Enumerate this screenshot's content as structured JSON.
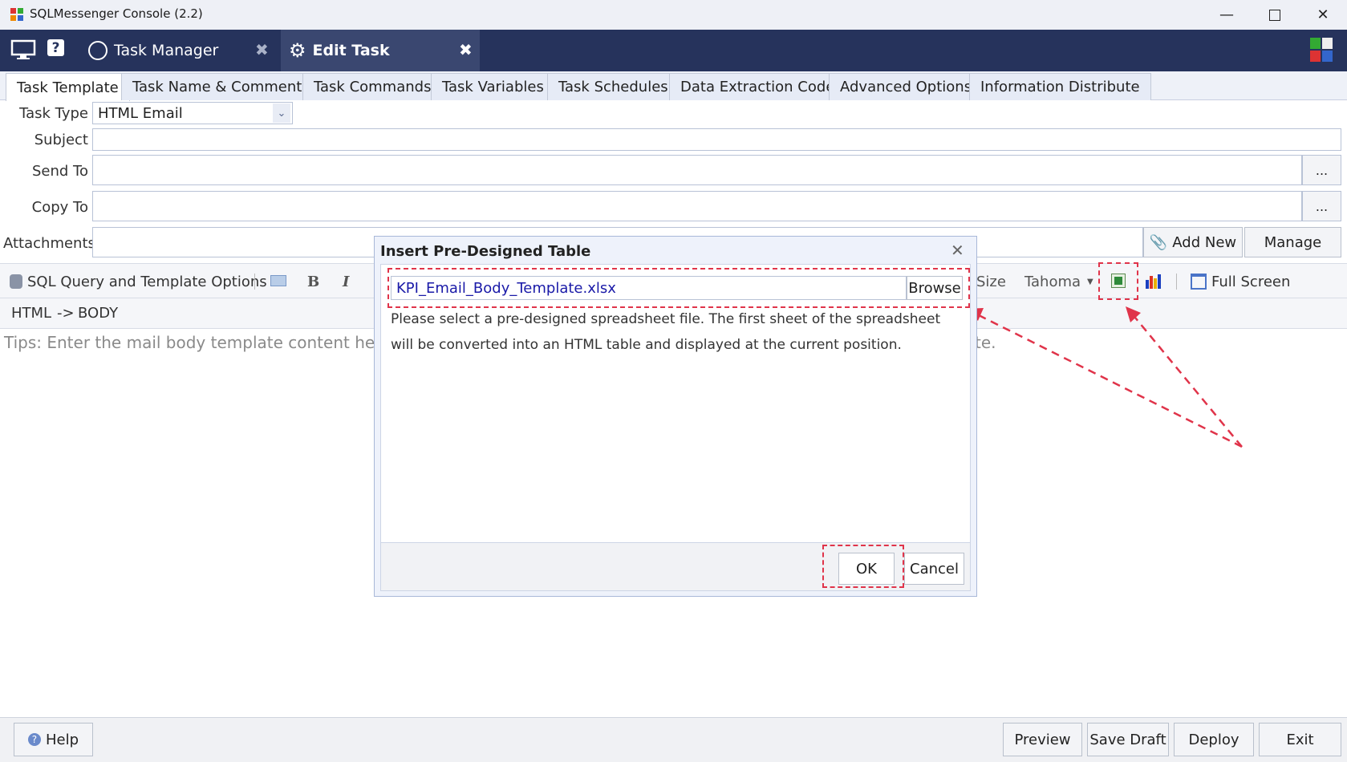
{
  "window": {
    "title": "SQLMessenger Console (2.2)",
    "controls": [
      "minimize-icon",
      "maximize-icon",
      "close-icon"
    ]
  },
  "nav": {
    "tabs": [
      {
        "label": "Task Manager",
        "icon": "task-manager-icon"
      },
      {
        "label": "Edit Task",
        "icon": "gear-icon"
      }
    ]
  },
  "subtabs": [
    "Task Template",
    "Task Name & Comments",
    "Task Commands",
    "Task Variables",
    "Task Schedules",
    "Data Extraction Code",
    "Advanced Options",
    "Information Distribute"
  ],
  "form": {
    "task_type_label": "Task Type",
    "task_type_value": "HTML Email",
    "subject_label": "Subject",
    "send_to_label": "Send To",
    "copy_to_label": "Copy To",
    "attachments_label": "Attachments",
    "dots_label": "...",
    "add_new_label": "Add New",
    "manage_label": "Manage"
  },
  "toolbar": {
    "sql_options_label": "SQL Query and Template Options",
    "bold_label": "B",
    "italic_label": "I",
    "size_label": "Size",
    "font_label": "Tahoma",
    "full_screen_label": "Full Screen"
  },
  "breadcrumb": {
    "html": "HTML",
    "arrow": "->",
    "body": "BODY"
  },
  "editor": {
    "tip_left": "Tips: Enter the mail body template content here,",
    "tip_right": "te."
  },
  "dialog": {
    "title": "Insert Pre-Designed Table",
    "file_value": "KPI_Email_Body_Template.xlsx",
    "browse_label": "Browse",
    "desc_line1": "Please select a pre-designed spreadsheet file. The first sheet of the spreadsheet",
    "desc_line2": "will be converted into an HTML table and displayed at the current position.",
    "ok_label": "OK",
    "cancel_label": "Cancel"
  },
  "footer": {
    "help_label": "Help",
    "preview_label": "Preview",
    "save_draft_label": "Save Draft",
    "deploy_label": "Deploy",
    "exit_label": "Exit"
  },
  "colors": {
    "accent": "#26335c",
    "annotation": "#e0344a",
    "link": "#1a1aa8"
  }
}
